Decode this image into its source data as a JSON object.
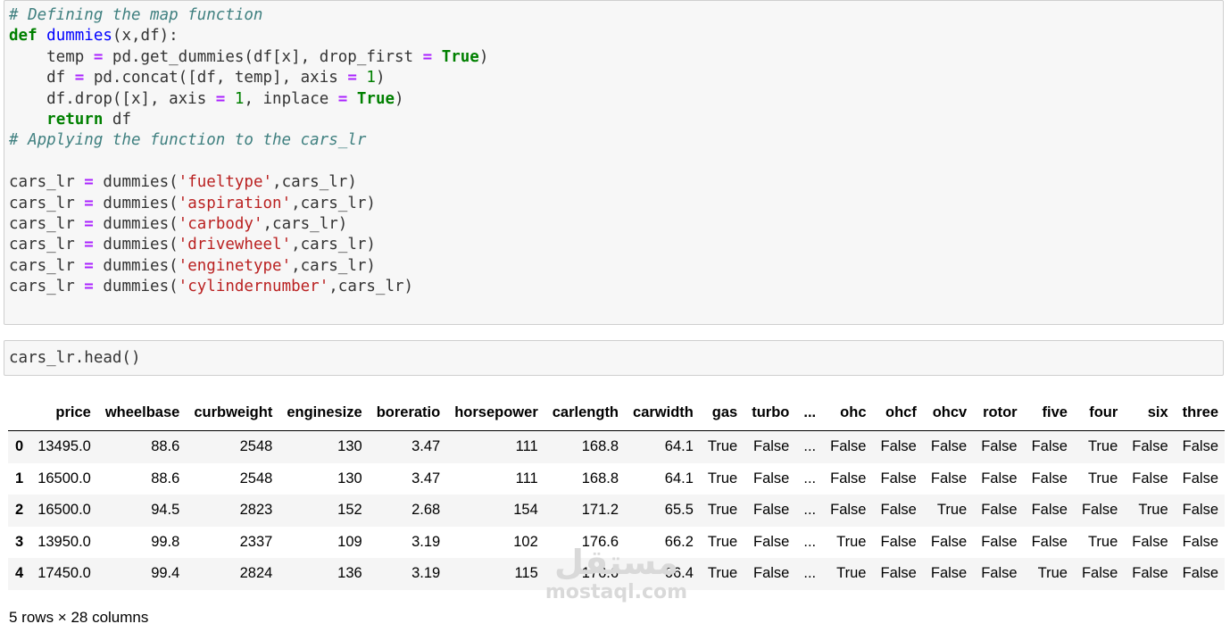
{
  "cell1": {
    "lines": [
      [
        {
          "t": "# Defining the map function",
          "c": "cm"
        }
      ],
      [
        {
          "t": "def",
          "c": "kw"
        },
        {
          "t": " "
        },
        {
          "t": "dummies",
          "c": "fn"
        },
        {
          "t": "(x,df):"
        }
      ],
      [
        {
          "t": "    temp "
        },
        {
          "t": "=",
          "c": "op"
        },
        {
          "t": " pd.get_dummies(df[x], drop_first "
        },
        {
          "t": "=",
          "c": "op"
        },
        {
          "t": " "
        },
        {
          "t": "True",
          "c": "kw"
        },
        {
          "t": ")"
        }
      ],
      [
        {
          "t": "    df "
        },
        {
          "t": "=",
          "c": "op"
        },
        {
          "t": " pd.concat([df, temp], axis "
        },
        {
          "t": "=",
          "c": "op"
        },
        {
          "t": " "
        },
        {
          "t": "1",
          "c": "num"
        },
        {
          "t": ")"
        }
      ],
      [
        {
          "t": "    df.drop([x], axis "
        },
        {
          "t": "=",
          "c": "op"
        },
        {
          "t": " "
        },
        {
          "t": "1",
          "c": "num"
        },
        {
          "t": ", inplace "
        },
        {
          "t": "=",
          "c": "op"
        },
        {
          "t": " "
        },
        {
          "t": "True",
          "c": "kw"
        },
        {
          "t": ")"
        }
      ],
      [
        {
          "t": "    "
        },
        {
          "t": "return",
          "c": "kw"
        },
        {
          "t": " df"
        }
      ],
      [
        {
          "t": "# Applying the function to the cars_lr",
          "c": "cm"
        }
      ],
      [
        {
          "t": ""
        }
      ],
      [
        {
          "t": "cars_lr "
        },
        {
          "t": "=",
          "c": "op"
        },
        {
          "t": " dummies("
        },
        {
          "t": "'fueltype'",
          "c": "str"
        },
        {
          "t": ",cars_lr)"
        }
      ],
      [
        {
          "t": "cars_lr "
        },
        {
          "t": "=",
          "c": "op"
        },
        {
          "t": " dummies("
        },
        {
          "t": "'aspiration'",
          "c": "str"
        },
        {
          "t": ",cars_lr)"
        }
      ],
      [
        {
          "t": "cars_lr "
        },
        {
          "t": "=",
          "c": "op"
        },
        {
          "t": " dummies("
        },
        {
          "t": "'carbody'",
          "c": "str"
        },
        {
          "t": ",cars_lr)"
        }
      ],
      [
        {
          "t": "cars_lr "
        },
        {
          "t": "=",
          "c": "op"
        },
        {
          "t": " dummies("
        },
        {
          "t": "'drivewheel'",
          "c": "str"
        },
        {
          "t": ",cars_lr)"
        }
      ],
      [
        {
          "t": "cars_lr "
        },
        {
          "t": "=",
          "c": "op"
        },
        {
          "t": " dummies("
        },
        {
          "t": "'enginetype'",
          "c": "str"
        },
        {
          "t": ",cars_lr)"
        }
      ],
      [
        {
          "t": "cars_lr "
        },
        {
          "t": "=",
          "c": "op"
        },
        {
          "t": " dummies("
        },
        {
          "t": "'cylindernumber'",
          "c": "str"
        },
        {
          "t": ",cars_lr)"
        }
      ]
    ]
  },
  "cell2": {
    "lines": [
      [
        {
          "t": "cars_lr.head()"
        }
      ]
    ]
  },
  "table": {
    "columns": [
      "",
      "price",
      "wheelbase",
      "curbweight",
      "enginesize",
      "boreratio",
      "horsepower",
      "carlength",
      "carwidth",
      "gas",
      "turbo",
      "...",
      "ohc",
      "ohcf",
      "ohcv",
      "rotor",
      "five",
      "four",
      "six",
      "three"
    ],
    "rows": [
      [
        "0",
        "13495.0",
        "88.6",
        "2548",
        "130",
        "3.47",
        "111",
        "168.8",
        "64.1",
        "True",
        "False",
        "...",
        "False",
        "False",
        "False",
        "False",
        "False",
        "True",
        "False",
        "False"
      ],
      [
        "1",
        "16500.0",
        "88.6",
        "2548",
        "130",
        "3.47",
        "111",
        "168.8",
        "64.1",
        "True",
        "False",
        "...",
        "False",
        "False",
        "False",
        "False",
        "False",
        "True",
        "False",
        "False"
      ],
      [
        "2",
        "16500.0",
        "94.5",
        "2823",
        "152",
        "2.68",
        "154",
        "171.2",
        "65.5",
        "True",
        "False",
        "...",
        "False",
        "False",
        "True",
        "False",
        "False",
        "False",
        "True",
        "False"
      ],
      [
        "3",
        "13950.0",
        "99.8",
        "2337",
        "109",
        "3.19",
        "102",
        "176.6",
        "66.2",
        "True",
        "False",
        "...",
        "True",
        "False",
        "False",
        "False",
        "False",
        "True",
        "False",
        "False"
      ],
      [
        "4",
        "17450.0",
        "99.4",
        "2824",
        "136",
        "3.19",
        "115",
        "176.6",
        "66.4",
        "True",
        "False",
        "...",
        "True",
        "False",
        "False",
        "False",
        "True",
        "False",
        "False",
        "False"
      ]
    ]
  },
  "shape_note": "5 rows × 28 columns",
  "watermark": {
    "logo": "مستقل",
    "url": "mostaql.com"
  }
}
